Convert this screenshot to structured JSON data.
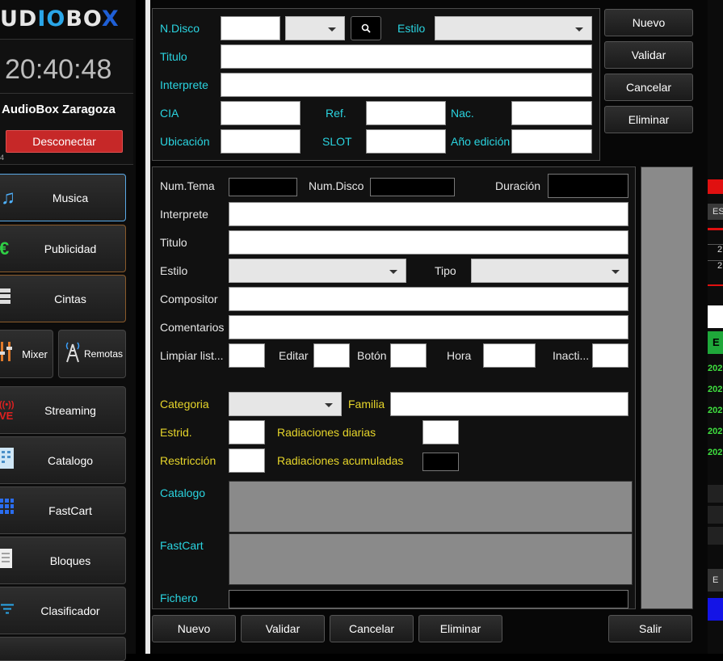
{
  "sidebar": {
    "logo": {
      "pre": "UD",
      "io": "IO",
      "box": "BO",
      "x": "X"
    },
    "clock": "20:40:48",
    "station": "AudioBox Zaragoza",
    "disconnect": "Desconectar",
    "small_text": "4",
    "items": {
      "musica": {
        "label": "Musica",
        "icon": "music-note-icon"
      },
      "publicidad": {
        "label": "Publicidad",
        "icon": "euro-icon"
      },
      "cintas": {
        "label": "Cintas",
        "icon": "tapes-icon"
      },
      "mixer": {
        "label": "Mixer",
        "icon": "mixer-icon"
      },
      "remotas": {
        "label": "Remotas",
        "icon": "antenna-icon"
      },
      "streaming": {
        "label": "Streaming",
        "icon": "live-icon",
        "icon_text": "VE"
      },
      "catalogo": {
        "label": "Catalogo",
        "icon": "catalog-icon"
      },
      "fastcart": {
        "label": "FastCart",
        "icon": "grid-icon"
      },
      "bloques": {
        "label": "Bloques",
        "icon": "document-icon"
      },
      "clasificador": {
        "label": "Clasificador",
        "icon": "filter-lines-icon"
      }
    }
  },
  "disc": {
    "ndisco": "N.Disco",
    "estilo": "Estilo",
    "titulo": "Titulo",
    "interprete": "Interprete",
    "cia": "CIA",
    "ref": "Ref.",
    "nac": "Nac.",
    "ubicacion": "Ubicación",
    "slot": "SLOT",
    "anio": "Año edición",
    "search_icon": "search-icon"
  },
  "top_buttons": {
    "nuevo": "Nuevo",
    "validar": "Validar",
    "cancelar": "Cancelar",
    "eliminar": "Eliminar"
  },
  "track": {
    "numtema": "Num.Tema",
    "numdisco": "Num.Disco",
    "duracion": "Duración",
    "interprete": "Interprete",
    "titulo": "Titulo",
    "estilo": "Estilo",
    "tipo": "Tipo",
    "compositor": "Compositor",
    "comentarios": "Comentarios",
    "limpiar": "Limpiar list...",
    "editar": "Editar",
    "boton": "Botón",
    "hora": "Hora",
    "inacti": "Inacti...",
    "categoria": "Categoria",
    "familia": "Familia",
    "estrid": "Estrid.",
    "rad_diarias": "Radiaciones diarias",
    "restriccion": "Restricción",
    "rad_acum": "Radiaciones acumuladas",
    "catalogo": "Catalogo",
    "fastcart": "FastCart",
    "fichero": "Fichero"
  },
  "bottom_buttons": {
    "nuevo": "Nuevo",
    "validar": "Validar",
    "cancelar": "Cancelar",
    "eliminar": "Eliminar",
    "salir": "Salir"
  },
  "right_strip": {
    "es": "ES",
    "v1": "2",
    "v2": "2",
    "e": "E",
    "r1": "202",
    "r2": "202",
    "r3": "202",
    "r4": "202",
    "r5": "202",
    "e2": "E"
  },
  "colors": {
    "cyan_label": "#2ad4e0",
    "yellow_label": "#e6d52a",
    "disconnect_red": "#c62828",
    "active_border": "#5aa9e6"
  }
}
